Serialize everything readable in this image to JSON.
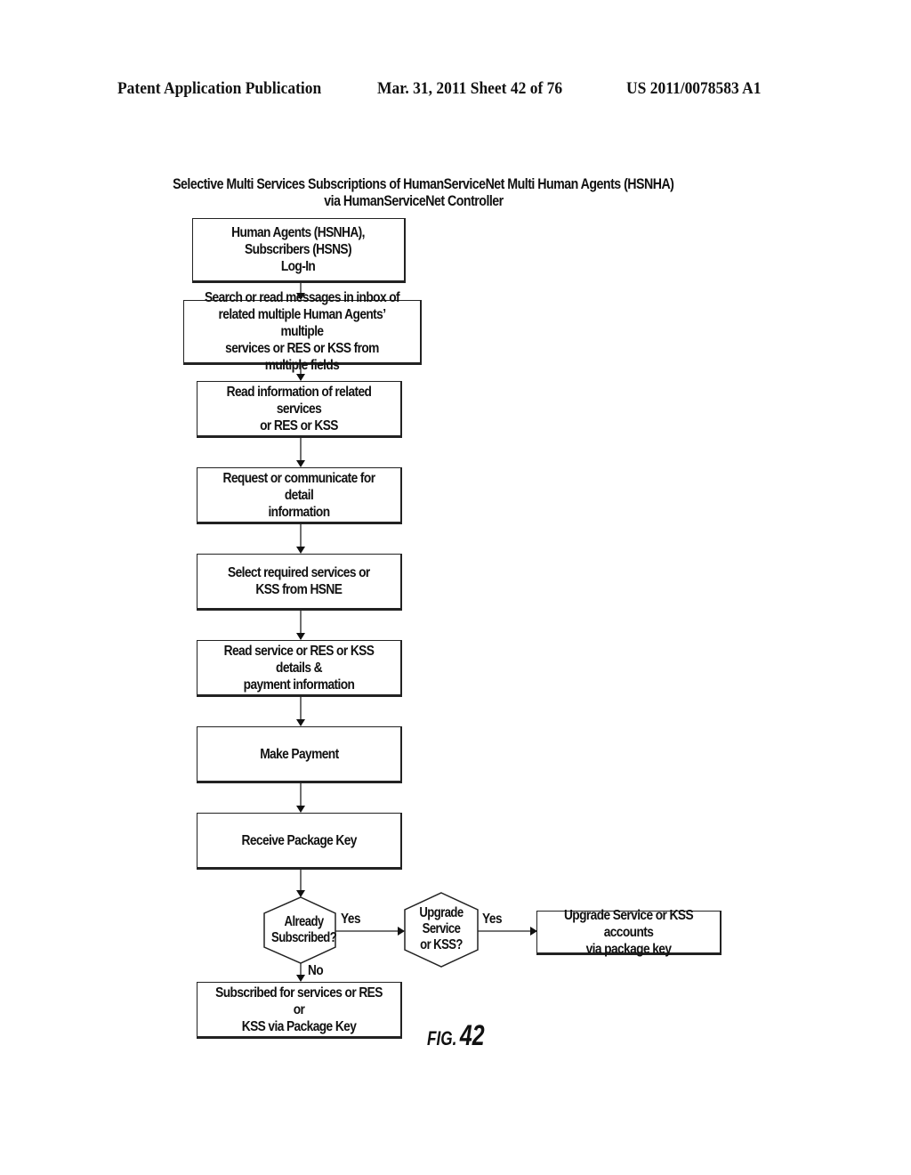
{
  "header": {
    "publication": "Patent Application Publication",
    "date_sheet": "Mar. 31, 2011  Sheet 42 of 76",
    "patent_number": "US 2011/0078583 A1"
  },
  "diagram": {
    "title_line1": "Selective Multi Services Subscriptions of HumanServiceNet Multi Human Agents (HSNHA)",
    "title_line2": "via HumanServiceNet Controller",
    "steps": [
      {
        "id": "login",
        "text": "Human Agents (HSNHA),\nSubscribers (HSNS)\nLog-In"
      },
      {
        "id": "search-messages",
        "text": "Search or read messages in inbox of\nrelated multiple Human Agents’ multiple\nservices or RES or KSS from multiple fields"
      },
      {
        "id": "read-info",
        "text": "Read information of related services\nor RES or KSS"
      },
      {
        "id": "request-detail",
        "text": "Request or communicate for detail\ninformation"
      },
      {
        "id": "select-services",
        "text": "Select required services or\nKSS from HSNE"
      },
      {
        "id": "read-details",
        "text": "Read service or RES or KSS details &\npayment information"
      },
      {
        "id": "make-payment",
        "text": "Make Payment"
      },
      {
        "id": "receive-key",
        "text": "Receive Package Key"
      }
    ],
    "decisions": [
      {
        "id": "already-subscribed",
        "text": "Already\nSubscribed?",
        "yes_label": "Yes",
        "no_label": "No"
      },
      {
        "id": "upgrade",
        "text": "Upgrade\nService\nor KSS?",
        "yes_label": "Yes"
      }
    ],
    "outcomes": {
      "upgrade_accounts": "Upgrade Service or KSS accounts\nvia package key",
      "subscribed": "Subscribed for services or RES or\nKSS via Package Key"
    },
    "figure_label_prefix": "FIG.",
    "figure_label_number": "42"
  }
}
